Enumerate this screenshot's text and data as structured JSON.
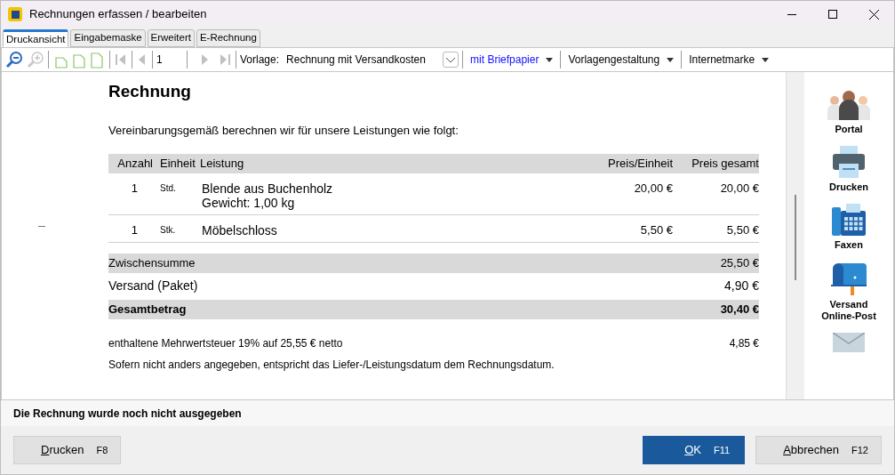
{
  "window": {
    "title": "Rechnungen erfassen / bearbeiten"
  },
  "tabs": [
    {
      "label": "Druckansicht",
      "selected": true
    },
    {
      "label": "Eingabemaske",
      "selected": false
    },
    {
      "label": "Erweitert",
      "selected": false
    },
    {
      "label": "E-Rechnung",
      "selected": false
    }
  ],
  "toolbar": {
    "page": "1",
    "template_label": "Vorlage:",
    "template": "Rechnung mit Versandkosten",
    "menus": [
      {
        "label": "mit Briefpapier",
        "kind": "link"
      },
      {
        "label": "Vorlagengestaltung",
        "kind": "plain"
      },
      {
        "label": "Internetmarke",
        "kind": "plain"
      }
    ]
  },
  "document": {
    "title": "Rechnung",
    "intro": "Vereinbarungsgemäß berechnen wir für unsere Leistungen wie folgt:",
    "columns": [
      "Anzahl",
      "Einheit",
      "Leistung",
      "Preis/Einheit",
      "Preis gesamt"
    ],
    "rows": [
      {
        "qty": "1",
        "unit": "Std.",
        "lines": [
          "Blende aus Buchenholz",
          "Gewicht: 1,00 kg"
        ],
        "price": "20,00 €",
        "total": "20,00 €"
      },
      {
        "qty": "1",
        "unit": "Stk.",
        "lines": [
          "Möbelschloss"
        ],
        "price": "5,50 €",
        "total": "5,50 €"
      }
    ],
    "summary": [
      {
        "label": "Zwischensumme",
        "value": "25,50 €",
        "kind": "shaded"
      },
      {
        "label": "Versand (Paket)",
        "value": "4,90 €",
        "kind": "large"
      },
      {
        "label": "Gesamtbetrag",
        "value": "30,40 €",
        "kind": "total"
      }
    ],
    "vat": {
      "label": "enthaltene Mehrwertsteuer 19% auf 25,55 € netto",
      "value": "4,85 €"
    },
    "note": "Sofern nicht anders angegeben, entspricht das Liefer-/Leistungsdatum dem Rechnungsdatum."
  },
  "side_actions": [
    {
      "label": "Portal",
      "kind": "people"
    },
    {
      "label": "Drucken",
      "kind": "printer"
    },
    {
      "label": "Faxen",
      "kind": "fax"
    },
    {
      "label": "Versand Online-Post",
      "kind": "mailbox"
    },
    {
      "kind": "mail"
    }
  ],
  "status": "Die Rechnung wurde noch nicht ausgegeben",
  "buttons": [
    {
      "label": "Drucken",
      "key": "F8",
      "kind": "default"
    },
    {
      "label": "OK",
      "key": "F11",
      "kind": "primary"
    },
    {
      "label": "Abbrechen",
      "key": "F12",
      "kind": "default"
    }
  ]
}
